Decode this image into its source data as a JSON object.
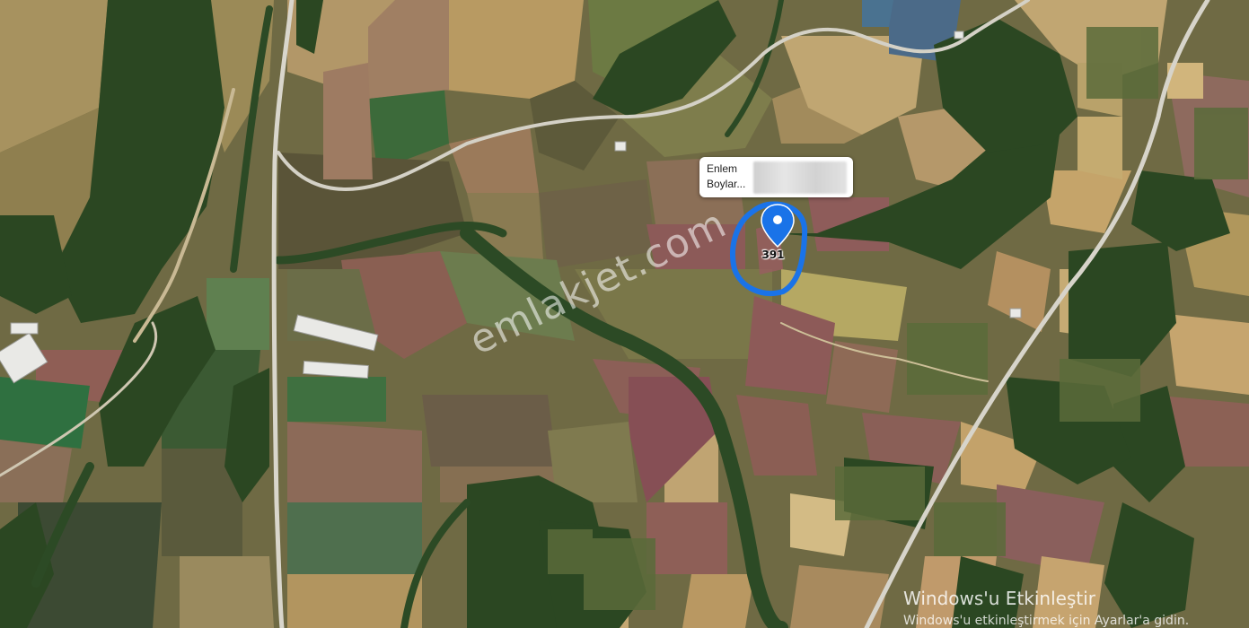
{
  "map": {
    "type": "satellite",
    "popup": {
      "line1": "Enlem",
      "line2": "Boylar..."
    },
    "marker": {
      "label": "391",
      "icon": "map-pin-icon"
    },
    "watermark": "emlakjet.com"
  },
  "windows_activation": {
    "title": "Windows'u Etkinleştir",
    "subtitle": "Windows'u etkinleştirmek için Ayarlar'a gidin."
  },
  "colors": {
    "marker": "#1a73e8",
    "forest": "#2c4a23",
    "field_light": "#b39a5e"
  }
}
